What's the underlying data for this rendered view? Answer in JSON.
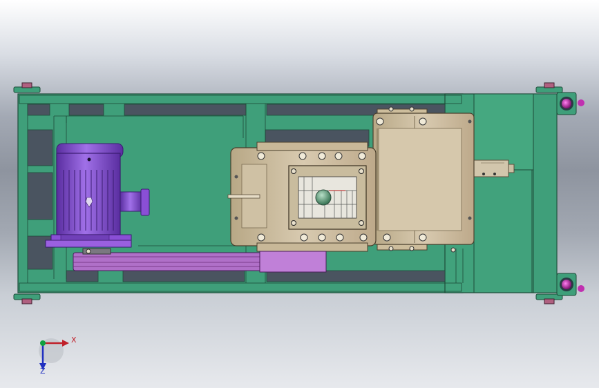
{
  "colors": {
    "background_top": "#ffffff",
    "background_mid": "#8e949f",
    "frame_green": "#3f9f7a",
    "frame_edge": "#1d4a38",
    "dark_slot": "#4a5460",
    "motor_purple": "#8a4fd6",
    "belt_purple": "#b070c8",
    "gearbox_tan": "#cdbd9c",
    "pin_magenta": "#c030b0",
    "axis_x": "#c0202a",
    "axis_y": "#2030c0",
    "axis_z": "#10a040"
  },
  "triad": {
    "x_label": "X",
    "z_label": "Z"
  }
}
